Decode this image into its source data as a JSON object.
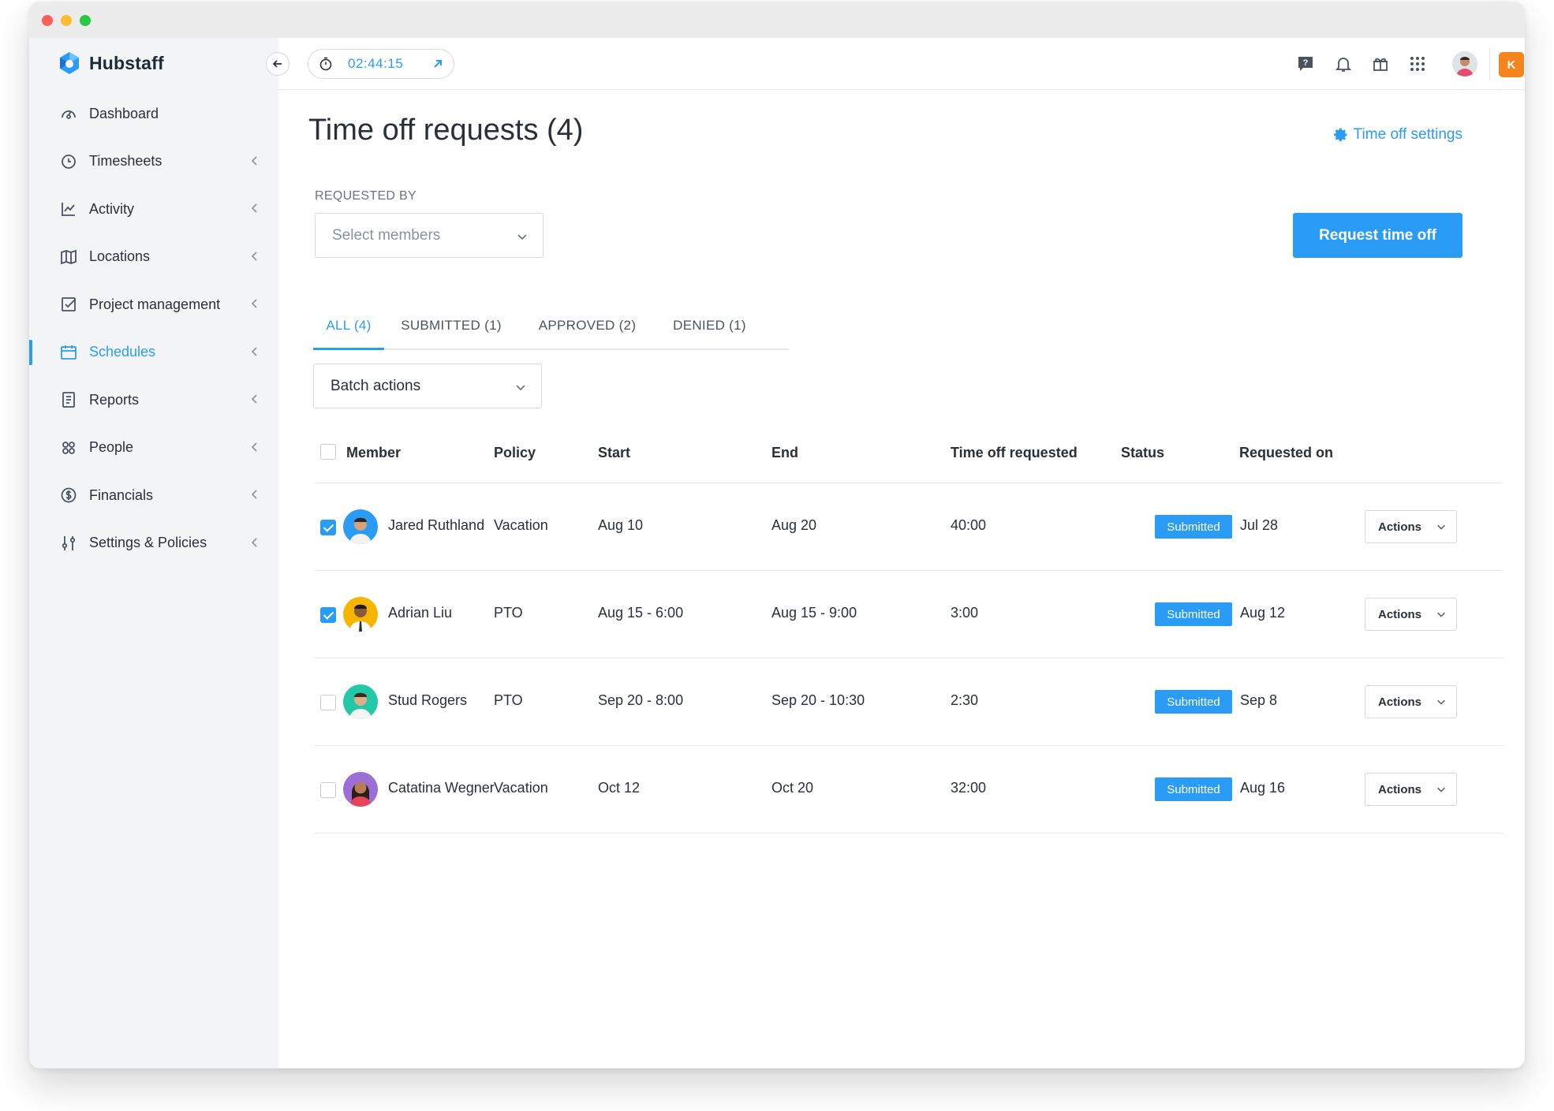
{
  "app": {
    "brand": "Hubstaff",
    "accent_color": "#2a9cf5",
    "org_color": "#f5841f"
  },
  "sidebar": {
    "items": [
      {
        "label": "Dashboard",
        "icon": "gauge-icon",
        "expandable": false,
        "active": false
      },
      {
        "label": "Timesheets",
        "icon": "clock-icon",
        "expandable": true,
        "active": false
      },
      {
        "label": "Activity",
        "icon": "line-chart-icon",
        "expandable": true,
        "active": false
      },
      {
        "label": "Locations",
        "icon": "map-icon",
        "expandable": true,
        "active": false
      },
      {
        "label": "Project management",
        "icon": "checkbox-icon",
        "expandable": true,
        "active": false
      },
      {
        "label": "Schedules",
        "icon": "calendar-icon",
        "expandable": true,
        "active": true
      },
      {
        "label": "Reports",
        "icon": "report-icon",
        "expandable": true,
        "active": false
      },
      {
        "label": "People",
        "icon": "people-icon",
        "expandable": true,
        "active": false
      },
      {
        "label": "Financials",
        "icon": "dollar-icon",
        "expandable": true,
        "active": false
      },
      {
        "label": "Settings & Policies",
        "icon": "sliders-icon",
        "expandable": true,
        "active": false
      }
    ]
  },
  "header": {
    "timer": "02:44:15",
    "org_initial": "K"
  },
  "main": {
    "title": "Time off requests (4)",
    "settings_link": "Time off settings",
    "filter_label": "REQUESTED BY",
    "members_placeholder": "Select members",
    "request_button": "Request time off",
    "tabs": [
      {
        "label": "ALL (4)",
        "active": true
      },
      {
        "label": "SUBMITTED (1)",
        "active": false
      },
      {
        "label": "APPROVED (2)",
        "active": false
      },
      {
        "label": "DENIED (1)",
        "active": false
      }
    ],
    "batch_actions": "Batch actions"
  },
  "table": {
    "columns": [
      "Member",
      "Policy",
      "Start",
      "End",
      "Time off requested",
      "Status",
      "Requested on"
    ],
    "rows": [
      {
        "checked": true,
        "member": "Jared Ruthland",
        "policy": "Vacation",
        "start": "Aug 10",
        "end": "Aug 20",
        "time_off": "40:00",
        "status": "Submitted",
        "requested_on": "Jul 28",
        "action": "Actions",
        "avatar_bg": "#2a9cf5"
      },
      {
        "checked": true,
        "member": "Adrian Liu",
        "policy": "PTO",
        "start": "Aug 15  - 6:00",
        "end": "Aug 15  - 9:00",
        "time_off": "3:00",
        "status": "Submitted",
        "requested_on": "Aug 12",
        "action": "Actions",
        "avatar_bg": "#f7b500"
      },
      {
        "checked": false,
        "member": "Stud Rogers",
        "policy": "PTO",
        "start": "Sep 20  - 8:00",
        "end": "Sep 20  - 10:30",
        "time_off": "2:30",
        "status": "Submitted",
        "requested_on": "Sep 8",
        "action": "Actions",
        "avatar_bg": "#23c9a6"
      },
      {
        "checked": false,
        "member": "Catatina Wegner",
        "policy": "Vacation",
        "start": "Oct 12",
        "end": "Oct 20",
        "time_off": "32:00",
        "status": "Submitted",
        "requested_on": "Aug 16",
        "action": "Actions",
        "avatar_bg": "#9b6fd6"
      }
    ]
  }
}
